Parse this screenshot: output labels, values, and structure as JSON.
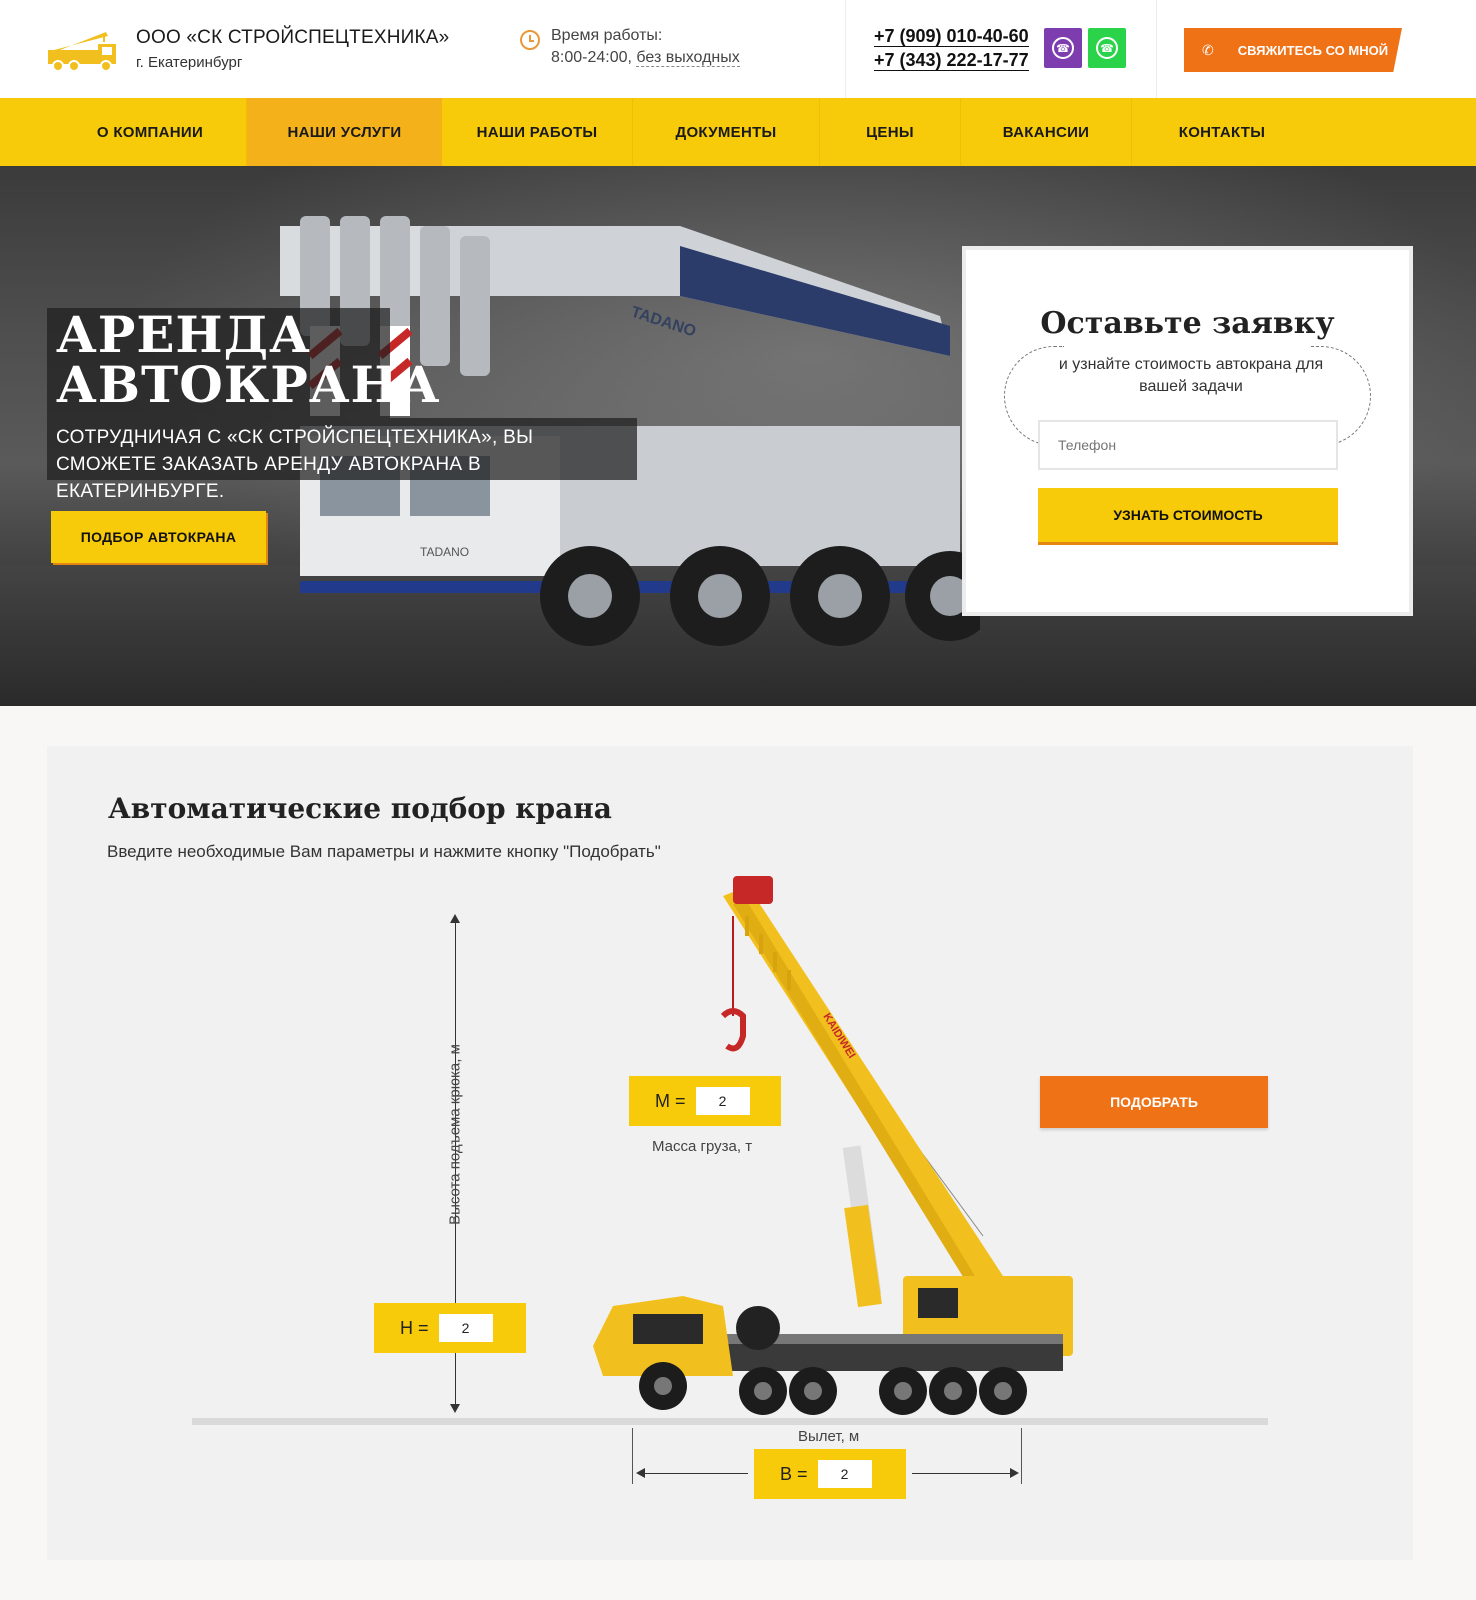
{
  "header": {
    "company": "ООО «СК СТРОЙСПЕЦТЕХНИКА»",
    "city": "г. Екатеринбург",
    "hours_label": "Время работы:",
    "hours_time": "8:00-24:00,",
    "hours_days": "без выходных",
    "phone1": "+7 (909) 010-40-60",
    "phone2": "+7 (343) 222-17-77",
    "callback_label": "СВЯЖИТЕСЬ СО МНОЙ",
    "icons": [
      "truck-logo-icon",
      "clock-icon",
      "viber-icon",
      "whatsapp-icon",
      "phone-icon"
    ],
    "colors": {
      "accent": "#f8cb0a",
      "orange": "#f07217",
      "viber": "#7d3daf",
      "whatsapp": "#2bd34a"
    }
  },
  "nav": {
    "items": [
      {
        "label": "О КОМПАНИИ"
      },
      {
        "label": "НАШИ УСЛУГИ",
        "active": true
      },
      {
        "label": "НАШИ РАБОТЫ"
      },
      {
        "label": "ДОКУМЕНТЫ"
      },
      {
        "label": "ЦЕНЫ"
      },
      {
        "label": "ВАКАНСИИ"
      },
      {
        "label": "КОНТАКТЫ"
      }
    ]
  },
  "hero": {
    "title_line1": "АРЕНДА",
    "title_line2": "АВТОКРАНА",
    "subtitle": "СОТРУДНИЧАЯ С «СК СТРОЙСПЕЦТЕХНИКА», ВЫ СМОЖЕТЕ ЗАКАЗАТЬ АРЕНДУ АВТОКРАНА В ЕКАТЕРИНБУРГЕ.",
    "button": "ПОДБОР АВТОКРАНА",
    "crane_brand": "TADANO"
  },
  "form": {
    "title": "Оставьте заявку",
    "subtitle": "и узнайте стоимость автокрана для вашей задачи",
    "phone_placeholder": "Телефон",
    "submit": "УЗНАТЬ СТОИМОСТЬ"
  },
  "selector": {
    "title": "Автоматические подбор крана",
    "subtitle": "Введите необходимые Вам параметры и нажмите кнопку \"Подобрать\"",
    "height_axis_label": "Высота подъема крюка, м",
    "h_label": "H =",
    "h_value": "2",
    "m_label": "M =",
    "m_value": "2",
    "mass_label": "Масса груза, т",
    "reach_label": "Вылет, м",
    "b_label": "B =",
    "b_value": "2",
    "button": "ПОДОБРАТЬ",
    "crane_brand": "KAIDIWEI"
  }
}
